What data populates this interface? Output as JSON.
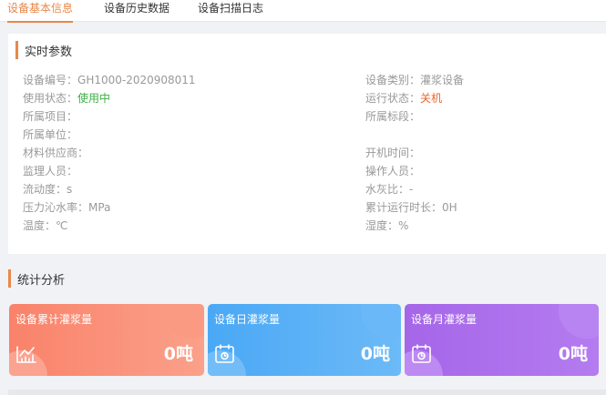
{
  "tabs": [
    {
      "label": "设备基本信息",
      "active": true
    },
    {
      "label": "设备历史数据",
      "active": false
    },
    {
      "label": "设备扫描日志",
      "active": false
    }
  ],
  "realtime": {
    "title": "实时参数",
    "left": [
      {
        "label": "设备编号：",
        "value": "GH1000-2020908011"
      },
      {
        "label": "使用状态：",
        "value": "使用中"
      },
      {
        "label": "所属项目：",
        "value": ""
      },
      {
        "label": "所属单位：",
        "value": ""
      },
      {
        "label": "材料供应商：",
        "value": ""
      },
      {
        "label": "监理人员：",
        "value": ""
      },
      {
        "label": "流动度：",
        "value": "s"
      },
      {
        "label": "压力沁水率：",
        "value": "MPa"
      },
      {
        "label": "温度：",
        "value": "℃"
      }
    ],
    "right": [
      {
        "label": "设备类别：",
        "value": "灌浆设备"
      },
      {
        "label": "运行状态：",
        "value": "关机"
      },
      {
        "label": "所属标段：",
        "value": ""
      },
      {
        "label": "开机时间：",
        "value": ""
      },
      {
        "label": "操作人员：",
        "value": ""
      },
      {
        "label": "水灰比：",
        "value": "-"
      },
      {
        "label": "累计运行时长：",
        "value": "0H"
      },
      {
        "label": "湿度：",
        "value": "%"
      }
    ]
  },
  "stats": {
    "title": "统计分析",
    "cards": [
      {
        "title": "设备累计灌浆量",
        "value": "0吨",
        "icon": "chart-icon",
        "color_from": "#f9826a",
        "color_to": "#fba08a"
      },
      {
        "title": "设备日灌浆量",
        "value": "0吨",
        "icon": "calendar-icon",
        "color_from": "#4aa8f5",
        "color_to": "#6cbaf7"
      },
      {
        "title": "设备月灌浆量",
        "value": "0吨",
        "icon": "calendar-icon",
        "color_from": "#a566e8",
        "color_to": "#b47cf0"
      }
    ]
  },
  "colors": {
    "accent": "#e8884a",
    "status_green": "#3cb043",
    "status_orange": "#e8662a"
  }
}
